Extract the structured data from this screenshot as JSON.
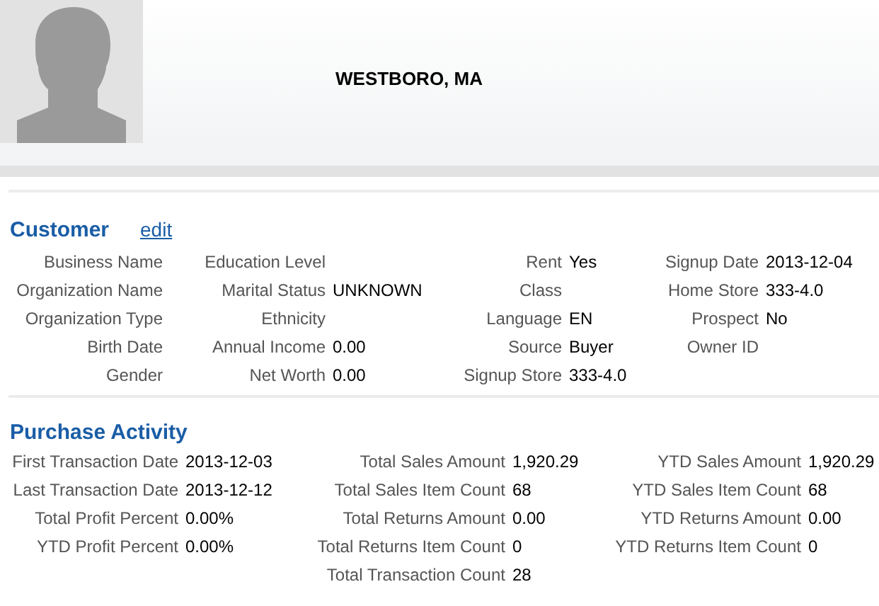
{
  "header": {
    "location": "WESTBORO, MA"
  },
  "customer": {
    "title": "Customer",
    "edit_link": "edit",
    "columns": [
      {
        "fields": [
          {
            "label": "Business Name"
          },
          {
            "label": "Organization Name"
          },
          {
            "label": "Organization Type"
          },
          {
            "label": "Birth Date"
          },
          {
            "label": "Gender"
          }
        ]
      },
      {
        "fields": [
          {
            "label": "Education Level"
          },
          {
            "label": "Marital Status",
            "value": "UNKNOWN"
          },
          {
            "label": "Ethnicity"
          },
          {
            "label": "Annual Income",
            "value": "0.00"
          },
          {
            "label": "Net Worth",
            "value": "0.00"
          }
        ]
      },
      {
        "fields": [
          {
            "label": "Rent",
            "value": "Yes"
          },
          {
            "label": "Class"
          },
          {
            "label": "Language",
            "value": "EN"
          },
          {
            "label": "Source",
            "value": "Buyer"
          },
          {
            "label": "Signup Store",
            "value": "333-4.0"
          }
        ]
      },
      {
        "fields": [
          {
            "label": "Signup Date",
            "value": "2013-12-04"
          },
          {
            "label": "Home Store",
            "value": "333-4.0"
          },
          {
            "label": "Prospect",
            "value": "No"
          },
          {
            "label": "Owner ID"
          }
        ]
      }
    ]
  },
  "purchase_activity": {
    "title": "Purchase Activity",
    "columns": [
      {
        "fields": [
          {
            "label": "First Transaction Date",
            "value": "2013-12-03"
          },
          {
            "label": "Last Transaction Date",
            "value": "2013-12-12"
          },
          {
            "label": "Total Profit Percent",
            "value": "0.00%"
          },
          {
            "label": "YTD Profit Percent",
            "value": "0.00%"
          }
        ]
      },
      {
        "fields": [
          {
            "label": "Total Sales Amount",
            "value": "1,920.29"
          },
          {
            "label": "Total Sales Item Count",
            "value": "68"
          },
          {
            "label": "Total Returns Amount",
            "value": "0.00"
          },
          {
            "label": "Total Returns Item Count",
            "value": "0"
          },
          {
            "label": "Total Transaction Count",
            "value": "28"
          }
        ]
      },
      {
        "fields": [
          {
            "label": "YTD Sales Amount",
            "value": "1,920.29"
          },
          {
            "label": "YTD Sales Item Count",
            "value": "68"
          },
          {
            "label": "YTD Returns Amount",
            "value": "0.00"
          },
          {
            "label": "YTD Returns Item Count",
            "value": "0"
          }
        ]
      }
    ]
  }
}
